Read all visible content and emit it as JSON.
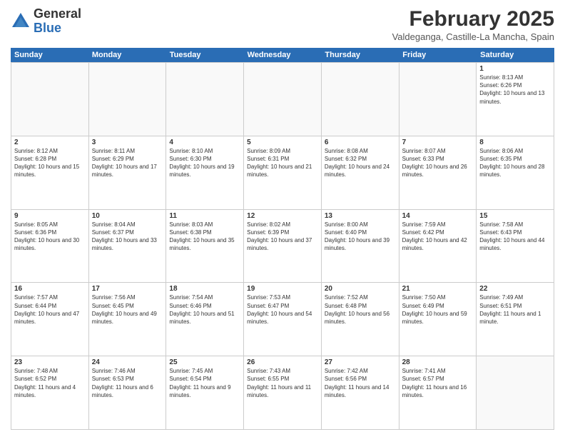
{
  "logo": {
    "general": "General",
    "blue": "Blue"
  },
  "header": {
    "title": "February 2025",
    "location": "Valdeganga, Castille-La Mancha, Spain"
  },
  "days": [
    "Sunday",
    "Monday",
    "Tuesday",
    "Wednesday",
    "Thursday",
    "Friday",
    "Saturday"
  ],
  "weeks": [
    [
      {
        "num": "",
        "info": ""
      },
      {
        "num": "",
        "info": ""
      },
      {
        "num": "",
        "info": ""
      },
      {
        "num": "",
        "info": ""
      },
      {
        "num": "",
        "info": ""
      },
      {
        "num": "",
        "info": ""
      },
      {
        "num": "1",
        "info": "Sunrise: 8:13 AM\nSunset: 6:26 PM\nDaylight: 10 hours and 13 minutes."
      }
    ],
    [
      {
        "num": "2",
        "info": "Sunrise: 8:12 AM\nSunset: 6:28 PM\nDaylight: 10 hours and 15 minutes."
      },
      {
        "num": "3",
        "info": "Sunrise: 8:11 AM\nSunset: 6:29 PM\nDaylight: 10 hours and 17 minutes."
      },
      {
        "num": "4",
        "info": "Sunrise: 8:10 AM\nSunset: 6:30 PM\nDaylight: 10 hours and 19 minutes."
      },
      {
        "num": "5",
        "info": "Sunrise: 8:09 AM\nSunset: 6:31 PM\nDaylight: 10 hours and 21 minutes."
      },
      {
        "num": "6",
        "info": "Sunrise: 8:08 AM\nSunset: 6:32 PM\nDaylight: 10 hours and 24 minutes."
      },
      {
        "num": "7",
        "info": "Sunrise: 8:07 AM\nSunset: 6:33 PM\nDaylight: 10 hours and 26 minutes."
      },
      {
        "num": "8",
        "info": "Sunrise: 8:06 AM\nSunset: 6:35 PM\nDaylight: 10 hours and 28 minutes."
      }
    ],
    [
      {
        "num": "9",
        "info": "Sunrise: 8:05 AM\nSunset: 6:36 PM\nDaylight: 10 hours and 30 minutes."
      },
      {
        "num": "10",
        "info": "Sunrise: 8:04 AM\nSunset: 6:37 PM\nDaylight: 10 hours and 33 minutes."
      },
      {
        "num": "11",
        "info": "Sunrise: 8:03 AM\nSunset: 6:38 PM\nDaylight: 10 hours and 35 minutes."
      },
      {
        "num": "12",
        "info": "Sunrise: 8:02 AM\nSunset: 6:39 PM\nDaylight: 10 hours and 37 minutes."
      },
      {
        "num": "13",
        "info": "Sunrise: 8:00 AM\nSunset: 6:40 PM\nDaylight: 10 hours and 39 minutes."
      },
      {
        "num": "14",
        "info": "Sunrise: 7:59 AM\nSunset: 6:42 PM\nDaylight: 10 hours and 42 minutes."
      },
      {
        "num": "15",
        "info": "Sunrise: 7:58 AM\nSunset: 6:43 PM\nDaylight: 10 hours and 44 minutes."
      }
    ],
    [
      {
        "num": "16",
        "info": "Sunrise: 7:57 AM\nSunset: 6:44 PM\nDaylight: 10 hours and 47 minutes."
      },
      {
        "num": "17",
        "info": "Sunrise: 7:56 AM\nSunset: 6:45 PM\nDaylight: 10 hours and 49 minutes."
      },
      {
        "num": "18",
        "info": "Sunrise: 7:54 AM\nSunset: 6:46 PM\nDaylight: 10 hours and 51 minutes."
      },
      {
        "num": "19",
        "info": "Sunrise: 7:53 AM\nSunset: 6:47 PM\nDaylight: 10 hours and 54 minutes."
      },
      {
        "num": "20",
        "info": "Sunrise: 7:52 AM\nSunset: 6:48 PM\nDaylight: 10 hours and 56 minutes."
      },
      {
        "num": "21",
        "info": "Sunrise: 7:50 AM\nSunset: 6:49 PM\nDaylight: 10 hours and 59 minutes."
      },
      {
        "num": "22",
        "info": "Sunrise: 7:49 AM\nSunset: 6:51 PM\nDaylight: 11 hours and 1 minute."
      }
    ],
    [
      {
        "num": "23",
        "info": "Sunrise: 7:48 AM\nSunset: 6:52 PM\nDaylight: 11 hours and 4 minutes."
      },
      {
        "num": "24",
        "info": "Sunrise: 7:46 AM\nSunset: 6:53 PM\nDaylight: 11 hours and 6 minutes."
      },
      {
        "num": "25",
        "info": "Sunrise: 7:45 AM\nSunset: 6:54 PM\nDaylight: 11 hours and 9 minutes."
      },
      {
        "num": "26",
        "info": "Sunrise: 7:43 AM\nSunset: 6:55 PM\nDaylight: 11 hours and 11 minutes."
      },
      {
        "num": "27",
        "info": "Sunrise: 7:42 AM\nSunset: 6:56 PM\nDaylight: 11 hours and 14 minutes."
      },
      {
        "num": "28",
        "info": "Sunrise: 7:41 AM\nSunset: 6:57 PM\nDaylight: 11 hours and 16 minutes."
      },
      {
        "num": "",
        "info": ""
      }
    ]
  ]
}
